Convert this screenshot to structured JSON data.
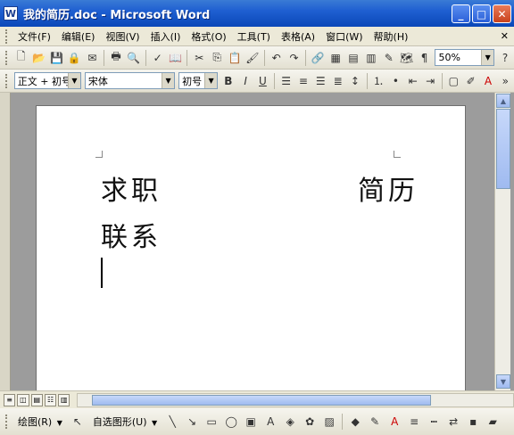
{
  "window": {
    "title": "我的简历.doc - Microsoft Word",
    "app_icon": "W",
    "minimize": "_",
    "maximize": "□",
    "close": "✕"
  },
  "menu": {
    "items": [
      "文件(F)",
      "编辑(E)",
      "视图(V)",
      "插入(I)",
      "格式(O)",
      "工具(T)",
      "表格(A)",
      "窗口(W)",
      "帮助(H)"
    ],
    "close_doc": "✕"
  },
  "toolbar1": {
    "zoom_value": "50%",
    "read_label": "阅读"
  },
  "toolbar2": {
    "style_value": "正文 + 初号",
    "font_value": "宋体",
    "size_value": "初号"
  },
  "document": {
    "line1_left": "求职",
    "line1_right": "简历",
    "line2": "联系"
  },
  "drawing": {
    "draw_label": "绘图(R)",
    "autoshape_label": "自选图形(U)"
  },
  "icons": {
    "new": "new-doc-icon",
    "open": "open-folder-icon",
    "save": "save-icon",
    "print": "print-icon",
    "bold": "bold-icon",
    "align": "align-icon"
  }
}
